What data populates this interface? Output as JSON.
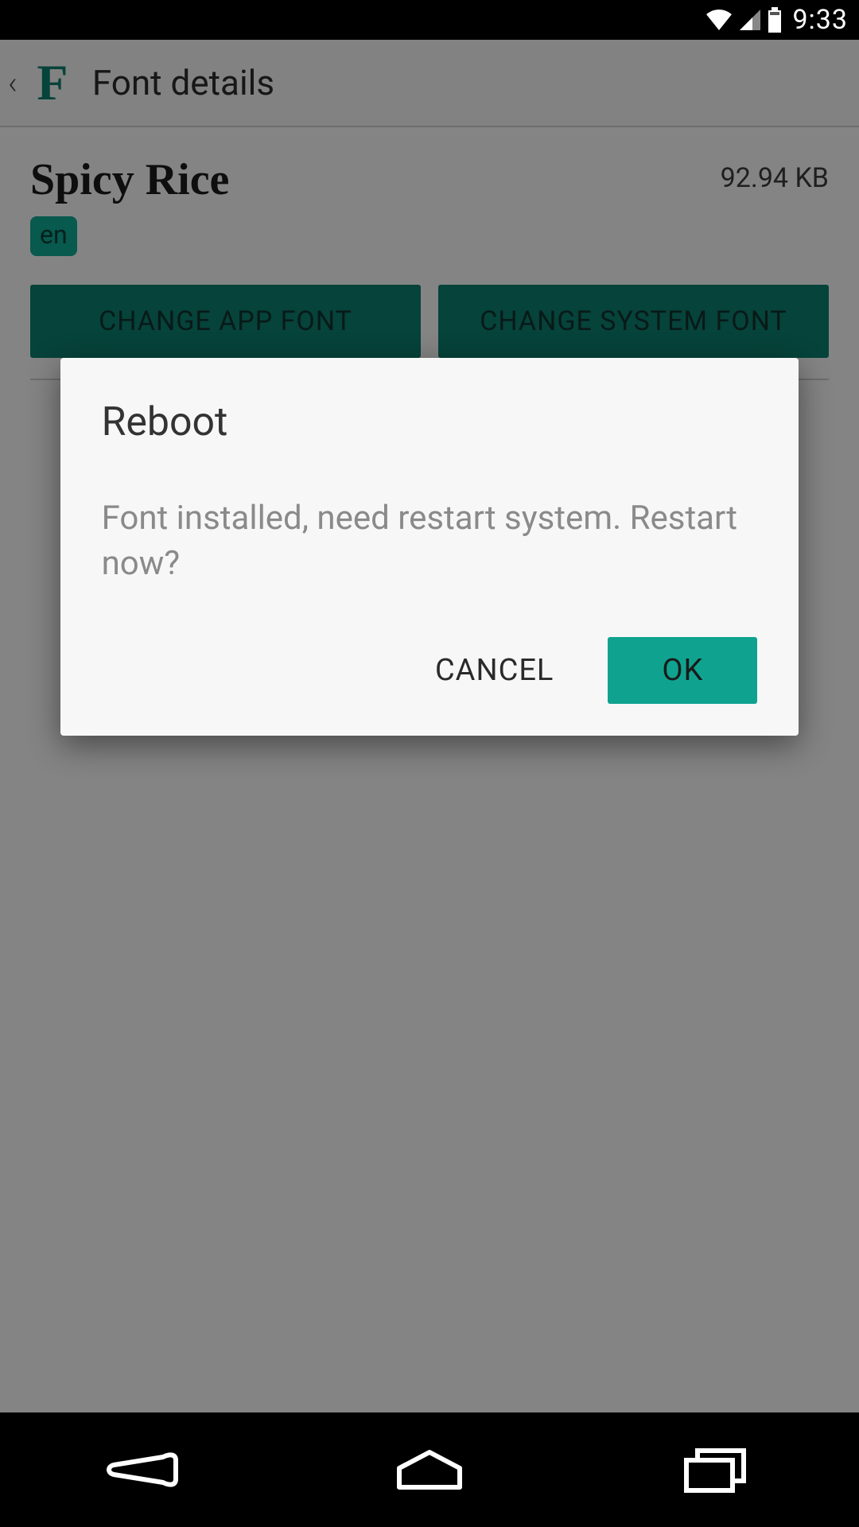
{
  "status": {
    "time": "9:33"
  },
  "action_bar": {
    "title": "Font details"
  },
  "font": {
    "name": "Spicy Rice",
    "size": "92.94 KB",
    "lang_badge": "en"
  },
  "buttons": {
    "change_app": "CHANGE APP FONT",
    "change_system": "CHANGE SYSTEM FONT"
  },
  "dialog": {
    "title": "Reboot",
    "message": "Font installed, need restart system. Restart now?",
    "cancel": "CANCEL",
    "ok": "OK"
  }
}
